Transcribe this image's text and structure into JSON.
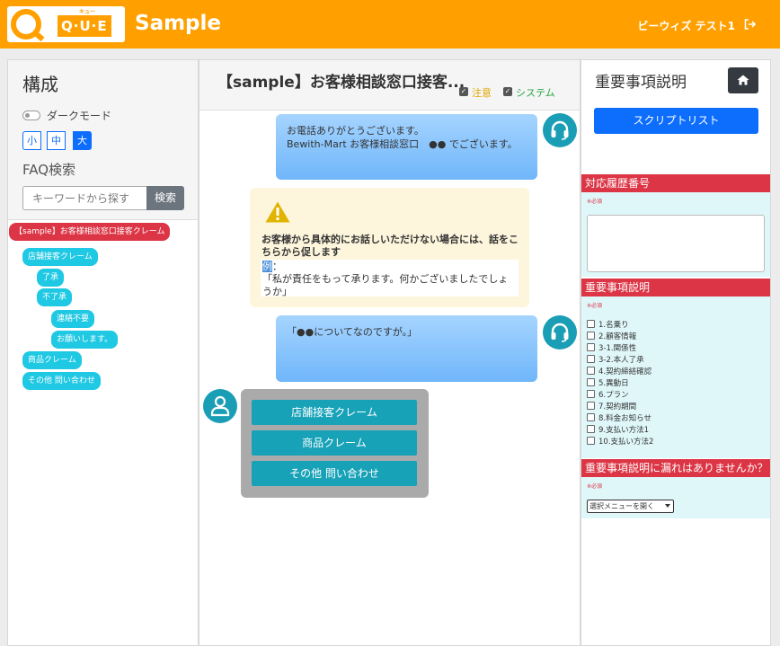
{
  "header": {
    "logo_text": "Q·U·E",
    "logo_kana": "キュー",
    "app_title": "Sample",
    "user_name": "ビーウィズ テスト1",
    "accent": "#ffa000"
  },
  "left": {
    "title": "構成",
    "dark_mode_label": "ダークモード",
    "font_sizes": [
      "小",
      "中",
      "大"
    ],
    "faq_title": "FAQ検索",
    "search_placeholder": "キーワードから探す",
    "search_button": "検索",
    "tree": {
      "root": "【sample】お客様相談窓口接客クレーム",
      "items": [
        "店舗接客クレーム",
        "了承",
        "不了承",
        "連絡不要",
        "お願いします。",
        "商品クレーム",
        "その他 問い合わせ"
      ]
    }
  },
  "center": {
    "title": "【sample】お客様相談窓口接客...",
    "filters": [
      "注意",
      "システム"
    ],
    "messages": [
      {
        "line1": "お電話ありがとうございます。",
        "line2": "Bewith-Mart お客様相談窓口　●● でございます。"
      },
      {
        "line1": "「●●についてなのですが。」"
      }
    ],
    "warning": {
      "text": "お客様から具体的にお話しいただけない場合には、話をこちらから促します",
      "example_label": "例",
      "example_colon": "：",
      "example_body": "「私が責任をもって承ります。何かございましたでしょうか」"
    },
    "choices": [
      "店舗接客クレーム",
      "商品クレーム",
      "その他 問い合わせ"
    ]
  },
  "right": {
    "title": "重要事項説明",
    "script_list_button": "スクリプトリスト",
    "sections": [
      {
        "title": "対応履歴番号",
        "required": "※必須"
      },
      {
        "title": "重要事項説明",
        "required": "※必須"
      },
      {
        "title": "重要事項説明に漏れはありませんか？",
        "required": "※必須"
      }
    ],
    "checklist": [
      "1.名乗り",
      "2.顧客情報",
      "3-1.関係性",
      "3-2.本人了承",
      "4.契約締結確認",
      "5.異動日",
      "6.プラン",
      "7.契約期間",
      "8.料金お知らせ",
      "9.支払い方法1",
      "10.支払い方法2"
    ],
    "select_value": "選択メニューを開く"
  }
}
